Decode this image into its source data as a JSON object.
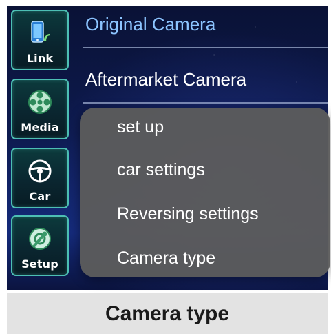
{
  "sidebar": {
    "items": [
      {
        "label": "Link",
        "icon": "phone-link-icon"
      },
      {
        "label": "Media",
        "icon": "film-reel-icon"
      },
      {
        "label": "Car",
        "icon": "steering-wheel-icon"
      },
      {
        "label": "Setup",
        "icon": "gear-setup-icon"
      }
    ]
  },
  "camera_options": {
    "original": "Original Camera",
    "aftermarket": "Aftermarket Camera"
  },
  "popup_menu": {
    "items": [
      "set up",
      "car settings",
      "Reversing settings",
      "Camera type"
    ]
  },
  "caption": {
    "text": "Camera type"
  },
  "colors": {
    "sidebar_border": "#4dbfb4",
    "original_text": "#8cc4ff",
    "popup_bg": "#5c5c5c",
    "caption_bg": "#e3e3e3"
  }
}
